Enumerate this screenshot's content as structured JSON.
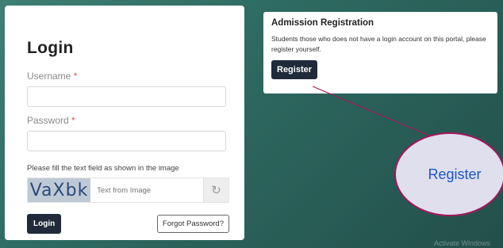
{
  "login": {
    "title": "Login",
    "username_label": "Username",
    "password_label": "Password",
    "required_mark": "*",
    "captcha_instruction": "Please fill the text field as shown in the image",
    "captcha_text": "VaXbk",
    "captcha_placeholder": "Text from Image",
    "login_button": "Login",
    "forgot_button": "Forgot Password?"
  },
  "admission": {
    "title": "Admission Registration",
    "description": "Students those who does not have a login account on this portal, please register yourself.",
    "register_button": "Register"
  },
  "callout": {
    "label": "Register",
    "border_color": "#a3185e",
    "fill_color": "#e0dfed",
    "text_color": "#1a56c8"
  },
  "watermark": "Activate Windows",
  "colors": {
    "dark_button": "#1f2b3a",
    "background": "#2f6c63"
  }
}
